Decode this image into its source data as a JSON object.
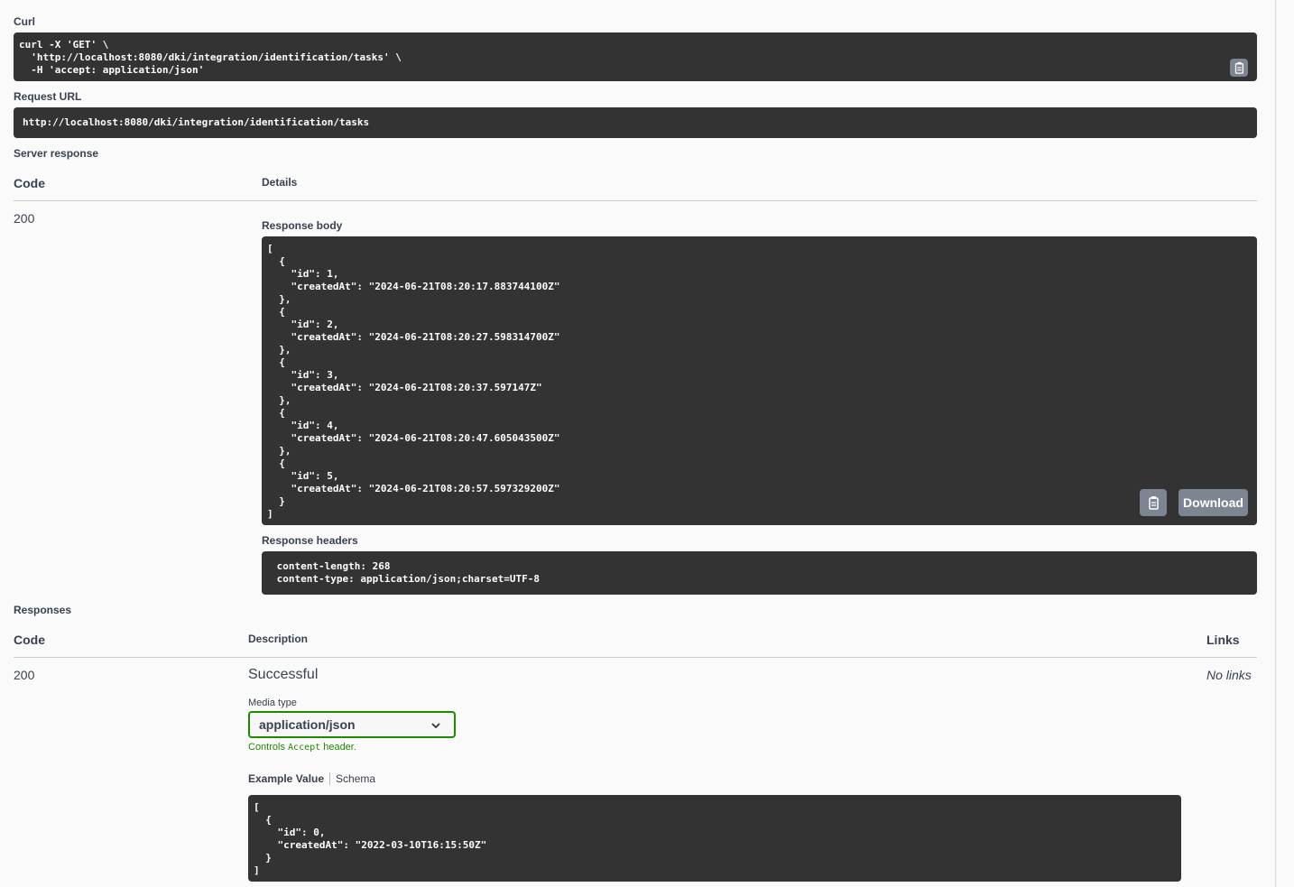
{
  "curl": {
    "label": "Curl",
    "command": "curl -X 'GET' \\\n  'http://localhost:8080/dki/integration/identification/tasks' \\\n  -H 'accept: application/json'"
  },
  "request_url": {
    "label": "Request URL",
    "value": "http://localhost:8080/dki/integration/identification/tasks"
  },
  "server_response": {
    "label": "Server response",
    "code_header": "Code",
    "details_header": "Details",
    "code": "200",
    "body_label": "Response body",
    "body": "[\n  {\n    \"id\": 1,\n    \"createdAt\": \"2024-06-21T08:20:17.883744100Z\"\n  },\n  {\n    \"id\": 2,\n    \"createdAt\": \"2024-06-21T08:20:27.598314700Z\"\n  },\n  {\n    \"id\": 3,\n    \"createdAt\": \"2024-06-21T08:20:37.597147Z\"\n  },\n  {\n    \"id\": 4,\n    \"createdAt\": \"2024-06-21T08:20:47.605043500Z\"\n  },\n  {\n    \"id\": 5,\n    \"createdAt\": \"2024-06-21T08:20:57.597329200Z\"\n  }\n]",
    "download_label": "Download",
    "headers_label": "Response headers",
    "headers": " content-length: 268 \n content-type: application/json;charset=UTF-8 "
  },
  "responses": {
    "label": "Responses",
    "code_header": "Code",
    "description_header": "Description",
    "links_header": "Links",
    "code": "200",
    "description": "Successful",
    "links": "No links",
    "media_type_label": "Media type",
    "media_type_value": "application/json",
    "controls_prefix": "Controls ",
    "controls_code": "Accept",
    "controls_suffix": " header.",
    "tab_example": "Example Value",
    "tab_schema": "Schema",
    "example": "[\n  {\n    \"id\": 0,\n    \"createdAt\": \"2022-03-10T16:15:50Z\"\n  }\n]"
  },
  "colors": {
    "code_bg": "#333333",
    "button_bg": "#7d8492",
    "media_border": "#1e8a00",
    "controls_text": "#1e8a00"
  },
  "icons": [
    "clipboard-icon",
    "chevron-down-icon"
  ]
}
